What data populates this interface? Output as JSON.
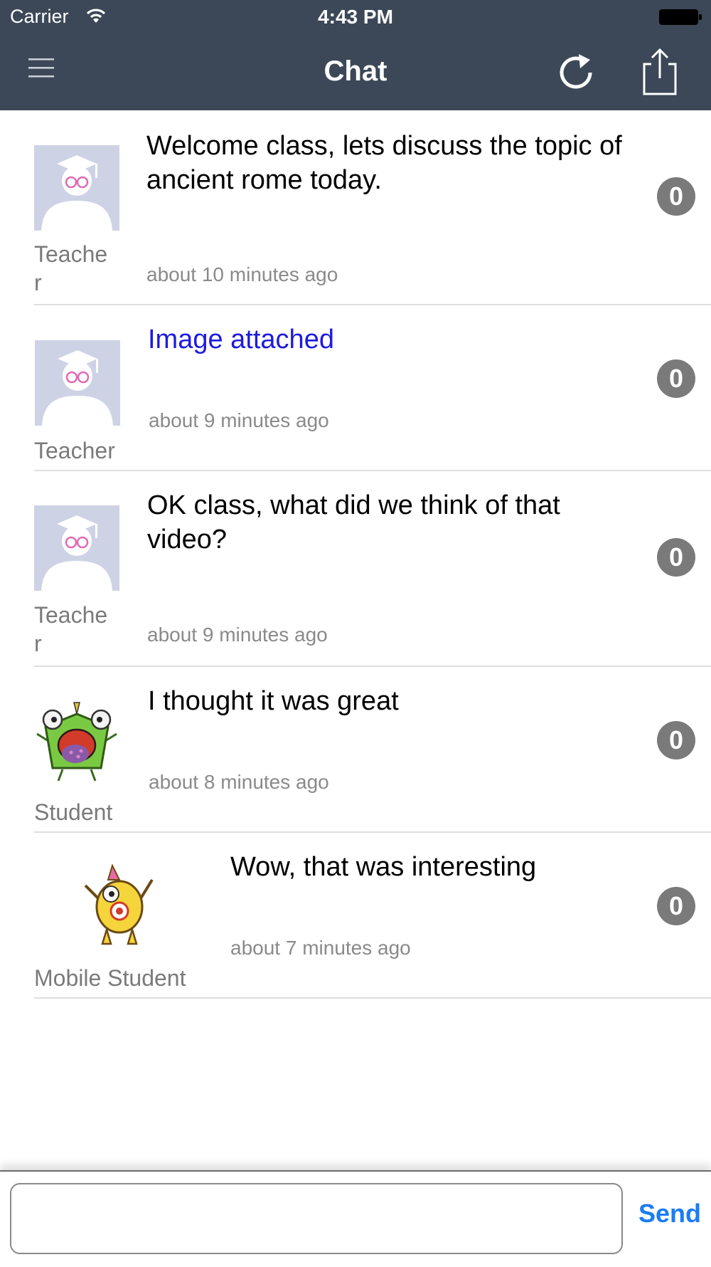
{
  "status_bar": {
    "carrier": "Carrier",
    "time": "4:43 PM"
  },
  "nav": {
    "title": "Chat",
    "icons": [
      "menu-icon",
      "refresh-icon",
      "share-icon"
    ]
  },
  "messages": [
    {
      "author": "Teacher",
      "author_display": "Teache\nr",
      "text": "Welcome class, lets discuss the topic of ancient rome today.",
      "time": "about 10 minutes ago",
      "count": "0",
      "avatar": "teacher-avatar-icon"
    },
    {
      "author": "Teacher",
      "author_display": "Teacher",
      "text": "Image attached",
      "time": "about 9 minutes ago",
      "count": "0",
      "avatar": "teacher-avatar-icon",
      "is_link": true
    },
    {
      "author": "Teacher",
      "author_display": "Teache\nr",
      "text": "OK class, what did we think of that video?",
      "time": "about 9 minutes ago",
      "count": "0",
      "avatar": "teacher-avatar-icon"
    },
    {
      "author": "Student",
      "author_display": "Student",
      "text": "I thought it was great",
      "time": "about 8 minutes ago",
      "count": "0",
      "avatar": "green-monster-avatar-icon"
    },
    {
      "author": "Mobile Student",
      "author_display": "Mobile Student",
      "text": "Wow, that was interesting",
      "time": "about 7 minutes ago",
      "count": "0",
      "avatar": "yellow-monster-avatar-icon"
    }
  ],
  "composer": {
    "input_value": "",
    "send_label": "Send"
  },
  "colors": {
    "header_bg": "#3c4857",
    "link": "#1d1ae0",
    "send": "#1a7cf5",
    "badge": "#7a7a7a"
  }
}
